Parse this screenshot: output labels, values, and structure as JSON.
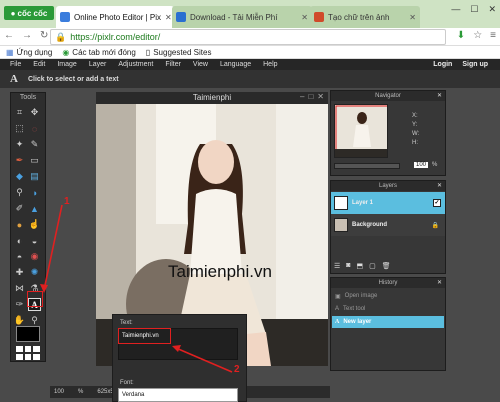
{
  "browser": {
    "logo": "cốc cốc",
    "tabs": [
      {
        "title": "Online Photo Editor | Pix"
      },
      {
        "title": "Download - Tải Miễn Phí"
      },
      {
        "title": "Tạo chữ trên ảnh"
      }
    ],
    "url": "https://pixlr.com/editor/",
    "bookmarks": [
      "Ứng dụng",
      "Các tab mới đóng",
      "Suggested Sites"
    ]
  },
  "editor": {
    "menu": [
      "File",
      "Edit",
      "Image",
      "Layer",
      "Adjustment",
      "Filter",
      "View",
      "Language",
      "Help"
    ],
    "account": {
      "login": "Login",
      "signup": "Sign up"
    },
    "option_hint": "Click to select or add a text",
    "tools_title": "Tools",
    "canvas": {
      "title": "Taimienphi",
      "overlay_text": "Taimienphi.vn"
    },
    "status": {
      "zoom": "100",
      "percent": "%",
      "size": "625x567 px"
    },
    "text_dialog": {
      "text_label": "Text:",
      "text_value": "Taimienphi.vn",
      "font_label": "Font:",
      "font_value": "Verdana"
    },
    "navigator": {
      "title": "Navigator",
      "x_label": "X:",
      "y_label": "Y:",
      "w_label": "W:",
      "h_label": "H:",
      "zoom": "100",
      "percent": "%"
    },
    "layers": {
      "title": "Layers",
      "items": [
        {
          "name": "Layer 1"
        },
        {
          "name": "Background"
        }
      ]
    },
    "history": {
      "title": "History",
      "items": [
        "Open image",
        "Text tool",
        "New layer"
      ]
    }
  },
  "annotations": {
    "step1": "1",
    "step2": "2"
  },
  "colors": {
    "accent": "#5bbedf",
    "annotation": "#e02020",
    "browser_green": "#2b9a38"
  }
}
